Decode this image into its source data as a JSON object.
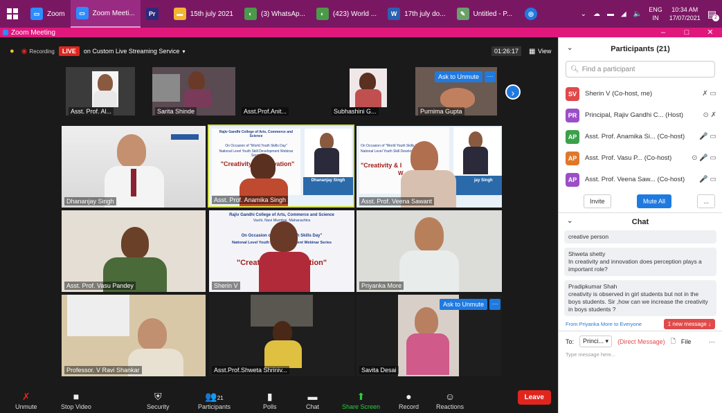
{
  "taskbar": {
    "items": [
      {
        "label": "Zoom",
        "color": "#2d8cff",
        "glyph": "▭"
      },
      {
        "label": "Zoom Meeti...",
        "color": "#2d8cff",
        "glyph": "▭"
      },
      {
        "label": "",
        "color": "#2b2b7a",
        "glyph": "Pr"
      },
      {
        "label": "15th july 2021",
        "color": "#f2b632",
        "glyph": "▬"
      },
      {
        "label": "(3) WhatsAp...",
        "color": "#4a9a4a",
        "glyph": "◐"
      },
      {
        "label": "(423) World ...",
        "color": "#4a9a4a",
        "glyph": "◐"
      },
      {
        "label": "17th july do...",
        "color": "#2b5fb0",
        "glyph": "W"
      },
      {
        "label": "Untitled - P...",
        "color": "#6aa06a",
        "glyph": "✎"
      }
    ],
    "lang": "ENG",
    "region": "IN",
    "time": "10:34 AM",
    "date": "17/07/2021",
    "notif_count": "2"
  },
  "window": {
    "title": "Zoom Meeting",
    "min": "–",
    "max": "□",
    "close": "✕"
  },
  "topbar": {
    "recording": "Recording",
    "live": "LIVE",
    "streaming": "on Custom Live Streaming Service",
    "timer": "01:26:17",
    "view": "View"
  },
  "strip": [
    {
      "name": "Asst. Prof. Al..."
    },
    {
      "name": "Sarita Shinde"
    },
    {
      "name": "Asst.Prof.Anit..."
    },
    {
      "name": "Subhashini G..."
    },
    {
      "name": "Purnima Gupta"
    }
  ],
  "grid": [
    {
      "name": "Dhananjay Singh"
    },
    {
      "name": "Asst. Prof. Anamika Singh"
    },
    {
      "name": "Asst. Prof. Veena Sawant"
    },
    {
      "name": "Asst. Prof. Vasu Pandey"
    },
    {
      "name": "Sherin V"
    },
    {
      "name": "Priyanka More"
    },
    {
      "name": "Professor. V Ravi Shankar"
    },
    {
      "name": "Asst.Prof.Shweta Shriniv..."
    },
    {
      "name": "Savita Desai"
    }
  ],
  "ask_unmute": "Ask to Unmute",
  "more": "···",
  "slide": {
    "college": "Rajiv Gandhi College of Arts, Commerce and Science",
    "occasion": "On Occasion of \"World Youth Skills Day\"",
    "series": "National Level Youth Skill Development Webinar Series",
    "topic": "\"Creativity & Innovation\"",
    "speaker": "Dhananjay Singh",
    "short1": "On Occasion of \"World Youth Skills Day\"",
    "short2": "National Level Youth Skill Development Webinar Series",
    "short_topic": "\"Creativity & Innovation\"",
    "speaker_short": "jay Singh",
    "topic_partial": "\"Creativity & I",
    "topic_partial2": "W",
    "big_college": "Rajiv Gandhi College of Arts, Commerce and Science",
    "big_place": "Vashi, Navi Mumbai, Maharashtra",
    "big_occ": "On Occasion of \"World Youth Skills Day\"",
    "big_series": "National Level Youth Skill Development Webinar Series",
    "big_topic": "\"Creativity & Innovation\""
  },
  "toolbar": {
    "unmute": "Unmute",
    "stop_video": "Stop Video",
    "security": "Security",
    "participants": "Participants",
    "participants_count": "21",
    "polls": "Polls",
    "chat": "Chat",
    "share": "Share Screen",
    "record": "Record",
    "reactions": "Reactions",
    "leave": "Leave"
  },
  "participants": {
    "title": "Participants (21)",
    "search_placeholder": "Find a participant",
    "list": [
      {
        "initials": "SV",
        "color": "#e0484a",
        "name": "Sherin V (Co-host, me)"
      },
      {
        "initials": "PR",
        "color": "#9b4fc7",
        "name": "Principal, Rajiv Gandhi C... (Host)"
      },
      {
        "initials": "AP",
        "color": "#3aa04a",
        "name": "Asst. Prof. Anamika Si... (Co-host)"
      },
      {
        "initials": "AP",
        "color": "#e0782a",
        "name": "Asst. Prof. Vasu P... (Co-host)"
      },
      {
        "initials": "AP",
        "color": "#9b4fc7",
        "name": "Asst. Prof. Veena Saw... (Co-host)"
      }
    ],
    "invite": "Invite",
    "mute_all": "Mute All",
    "more": "..."
  },
  "chat": {
    "title": "Chat",
    "messages": [
      {
        "text": "creative person"
      },
      {
        "sender": "Shweta shetty",
        "text": "In creativity and innovation does perception plays a important role?"
      },
      {
        "sender": "Pradipkumar Shah",
        "text": "creativity is observed in girl students but not in the boys students. Sir ,how can we increase the creativity in boys students ?"
      }
    ],
    "from": "From Priyanka More to Everyone",
    "new_message": "1 new message ↓",
    "to_label": "To:",
    "to_value": "Princi...",
    "direct": "(Direct Message)",
    "file": "File",
    "more": "···",
    "placeholder": "Type message here..."
  }
}
